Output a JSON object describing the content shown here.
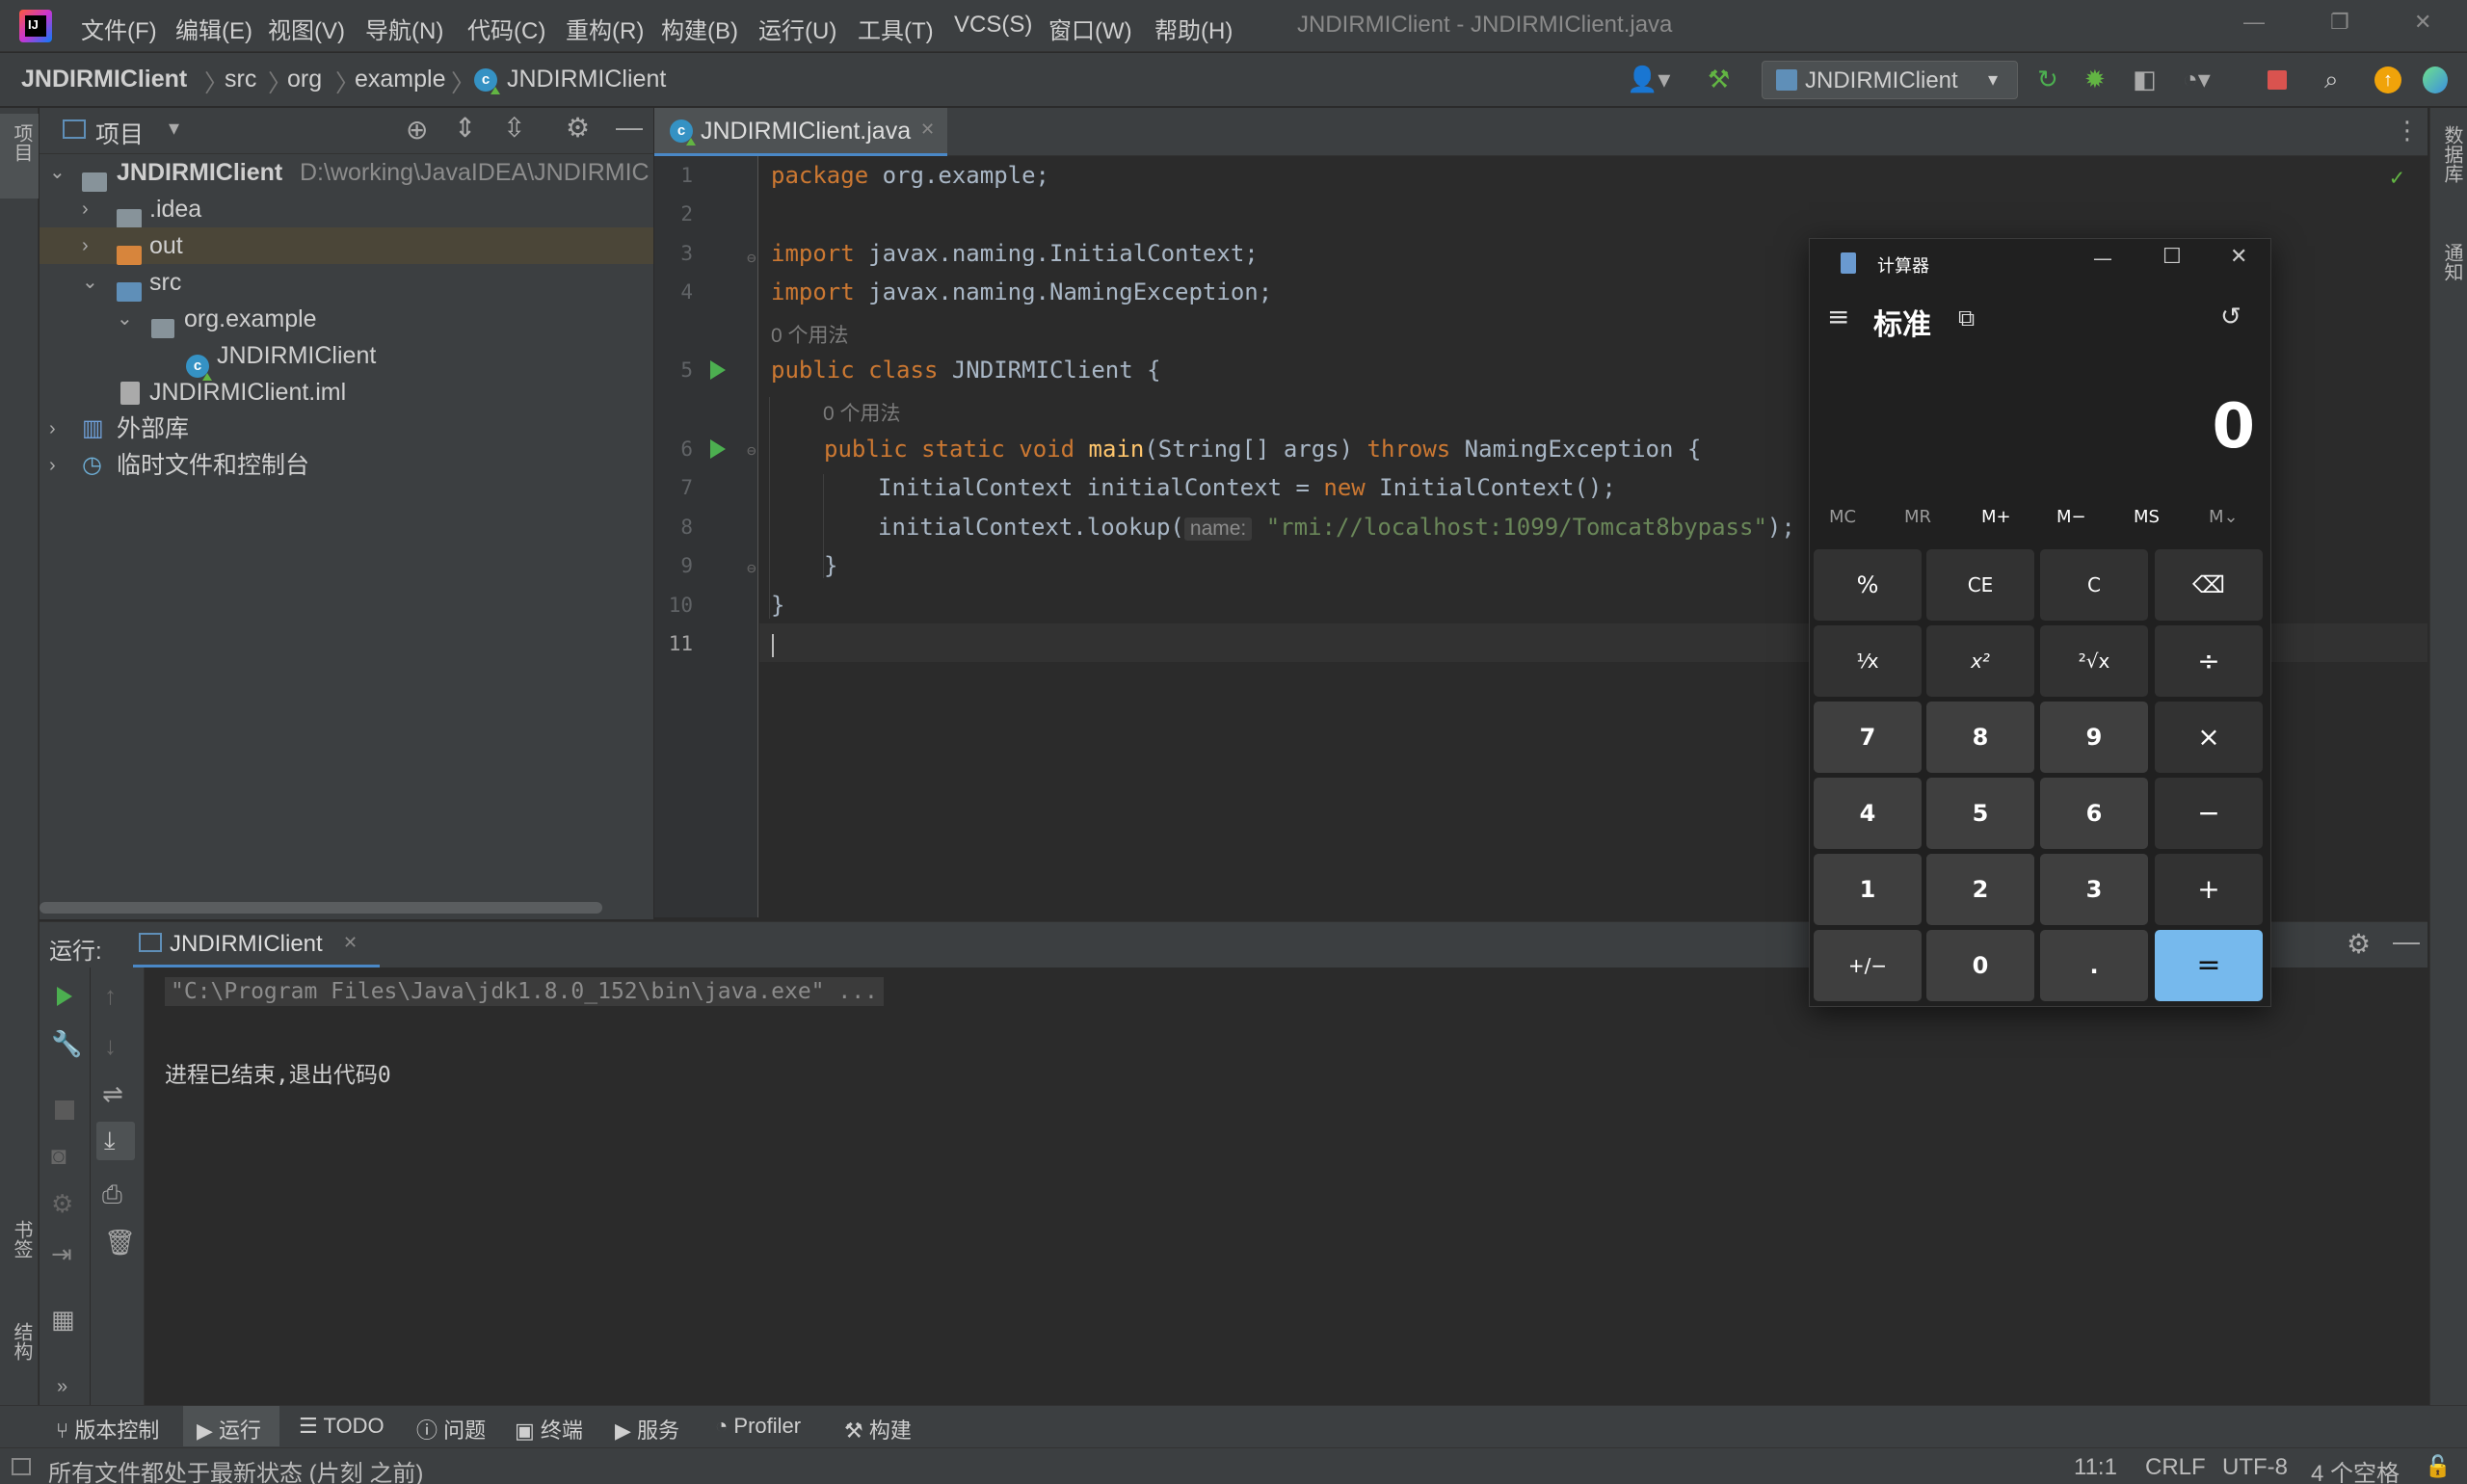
{
  "app": {
    "window_title": "JNDIRMIClient - JNDIRMIClient.java",
    "menu": [
      "文件(F)",
      "编辑(E)",
      "视图(V)",
      "导航(N)",
      "代码(C)",
      "重构(R)",
      "构建(B)",
      "运行(U)",
      "工具(T)",
      "VCS(S)",
      "窗口(W)",
      "帮助(H)"
    ]
  },
  "breadcrumb": [
    "JNDIRMIClient",
    "src",
    "org",
    "example",
    "JNDIRMIClient"
  ],
  "run_config": "JNDIRMIClient",
  "left_strip": {
    "project": "项目",
    "bookmarks": "书签",
    "structure": "结构"
  },
  "right_strip": {
    "database": "数据库",
    "notifications": "通知"
  },
  "project_panel": {
    "title": "项目",
    "tree": [
      {
        "label": "JNDIRMIClient",
        "path": "D:\\working\\JavaIDEA\\JNDIRMIC"
      },
      {
        "label": ".idea"
      },
      {
        "label": "out"
      },
      {
        "label": "src"
      },
      {
        "label": "org.example"
      },
      {
        "label": "JNDIRMIClient"
      },
      {
        "label": "JNDIRMIClient.iml"
      },
      {
        "label": "外部库"
      },
      {
        "label": "临时文件和控制台"
      }
    ]
  },
  "editor": {
    "tab": "JNDIRMIClient.java",
    "line_numbers": [
      "1",
      "2",
      "3",
      "4",
      "5",
      "6",
      "7",
      "8",
      "9",
      "10",
      "11"
    ],
    "usage_hint": "0 个用法",
    "param_hint": "name:",
    "code": {
      "l1_kw": "package",
      "l1_rest": " org.example;",
      "l3_kw": "import",
      "l3_rest": " javax.naming.InitialContext;",
      "l4_kw": "import",
      "l4_rest": " javax.naming.NamingException;",
      "l5_kw": "public class",
      "l5_rest": " JNDIRMIClient {",
      "l6_kw1": "public static void",
      "l6_fn": "main",
      "l6_mid": "(String[] args) ",
      "l6_kw2": "throws",
      "l6_rest": " NamingException {",
      "l7_a": "InitialContext initialContext = ",
      "l7_kw": "new",
      "l7_b": " InitialContext();",
      "l8_a": "initialContext.lookup(",
      "l8_str": "\"rmi://localhost:1099/Tomcat8bypass\"",
      "l8_b": ");",
      "l9": "}",
      "l10": "}"
    }
  },
  "run_panel": {
    "label": "运行:",
    "tab": "JNDIRMIClient",
    "command": "\"C:\\Program Files\\Java\\jdk1.8.0_152\\bin\\java.exe\" ...",
    "exit_message": "进程已结束,退出代码0"
  },
  "tool_windows": [
    "版本控制",
    "运行",
    "TODO",
    "问题",
    "终端",
    "服务",
    "Profiler",
    "构建"
  ],
  "status": {
    "message": "所有文件都处于最新状态 (片刻 之前)",
    "position": "11:1",
    "line_sep": "CRLF",
    "encoding": "UTF-8",
    "indent": "4 个空格"
  },
  "calculator": {
    "title": "计算器",
    "mode": "标准",
    "display": "0",
    "memory": [
      "MC",
      "MR",
      "M+",
      "M−",
      "MS",
      "M⌄"
    ],
    "keys": [
      "%",
      "CE",
      "C",
      "⌫",
      "¹⁄x",
      "x²",
      "²√x",
      "÷",
      "7",
      "8",
      "9",
      "×",
      "4",
      "5",
      "6",
      "−",
      "1",
      "2",
      "3",
      "+",
      "+/−",
      "0",
      ".",
      "="
    ]
  },
  "colors": {
    "accent": "#4a88c7",
    "keyword": "#cc7832",
    "string": "#6a8759",
    "function": "#ffc66d",
    "equals_key": "#76b9ed"
  }
}
